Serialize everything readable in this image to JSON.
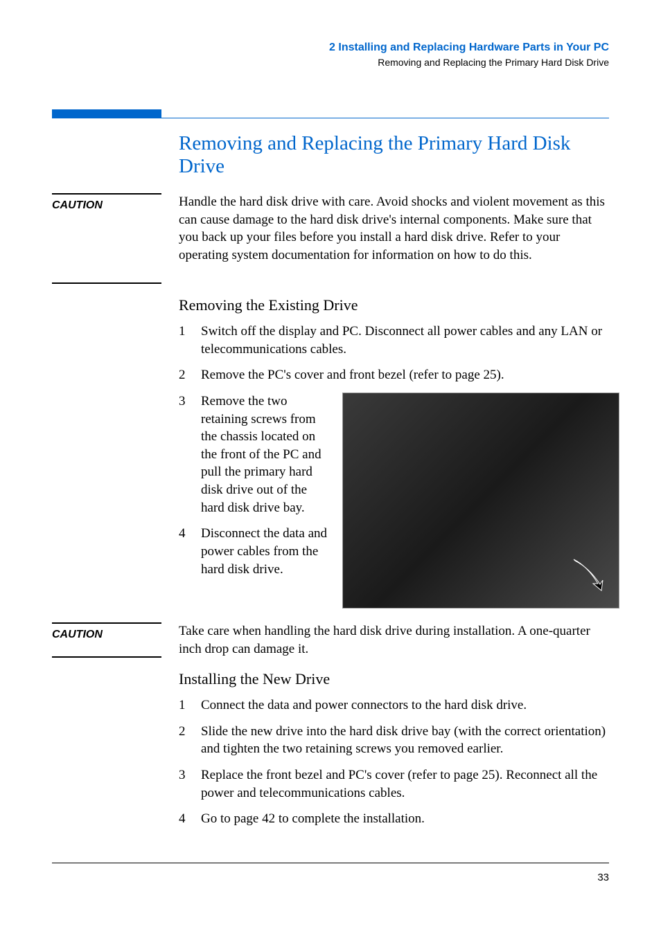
{
  "header": {
    "chapter": "2   Installing and Replacing Hardware Parts in Your PC",
    "subtitle": "Removing and Replacing the Primary Hard Disk Drive"
  },
  "main_heading": "Removing and Replacing the Primary Hard Disk Drive",
  "caution1": {
    "label": "CAUTION",
    "text": "Handle the hard disk drive with care. Avoid shocks and violent movement as this can cause damage to the hard disk drive's internal components. Make sure that you back up your files before you install a hard disk drive. Refer to your operating system documentation for information on how to do this."
  },
  "section1": {
    "heading": "Removing the Existing Drive",
    "steps": [
      "Switch off the display and PC. Disconnect all power cables and any LAN or telecommunications cables.",
      "Remove the PC's cover and front bezel (refer to page 25).",
      "Remove the two retaining screws from the chassis located on the front of the PC and pull the primary hard disk drive out of the hard disk drive bay.",
      "Disconnect the data and power cables from the hard disk drive."
    ]
  },
  "caution2": {
    "label": "CAUTION",
    "text": "Take care when handling the hard disk drive during installation. A one-quarter inch drop can damage it."
  },
  "section2": {
    "heading": "Installing the New Drive",
    "steps": [
      "Connect the data and power connectors to the hard disk drive.",
      "Slide the new drive into the hard disk drive bay (with the correct orientation) and tighten the two retaining screws you removed earlier.",
      "Replace the front bezel and PC's cover (refer to page 25). Reconnect all the power and telecommunications cables.",
      "Go to page 42 to complete the installation."
    ]
  },
  "page_number": "33"
}
